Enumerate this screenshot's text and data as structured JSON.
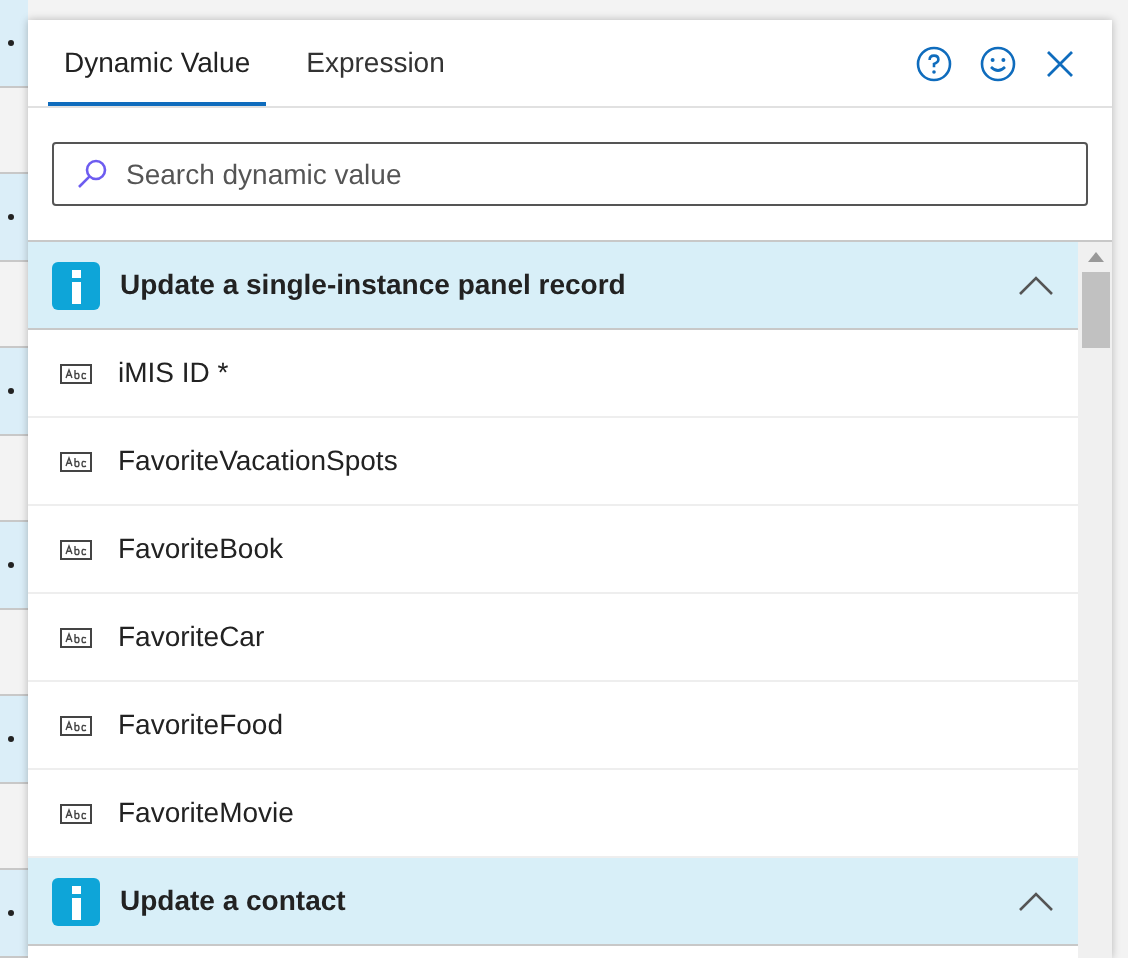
{
  "tabs": [
    {
      "label": "Dynamic Value",
      "selected": true
    },
    {
      "label": "Expression",
      "selected": false
    }
  ],
  "search": {
    "placeholder": "Search dynamic value"
  },
  "sections": [
    {
      "title": "Update a single-instance panel record",
      "expanded": true,
      "items": [
        {
          "label": "iMIS ID *"
        },
        {
          "label": "FavoriteVacationSpots"
        },
        {
          "label": "FavoriteBook"
        },
        {
          "label": "FavoriteCar"
        },
        {
          "label": "FavoriteFood"
        },
        {
          "label": "FavoriteMovie"
        }
      ]
    },
    {
      "title": "Update a contact",
      "expanded": true
    }
  ]
}
